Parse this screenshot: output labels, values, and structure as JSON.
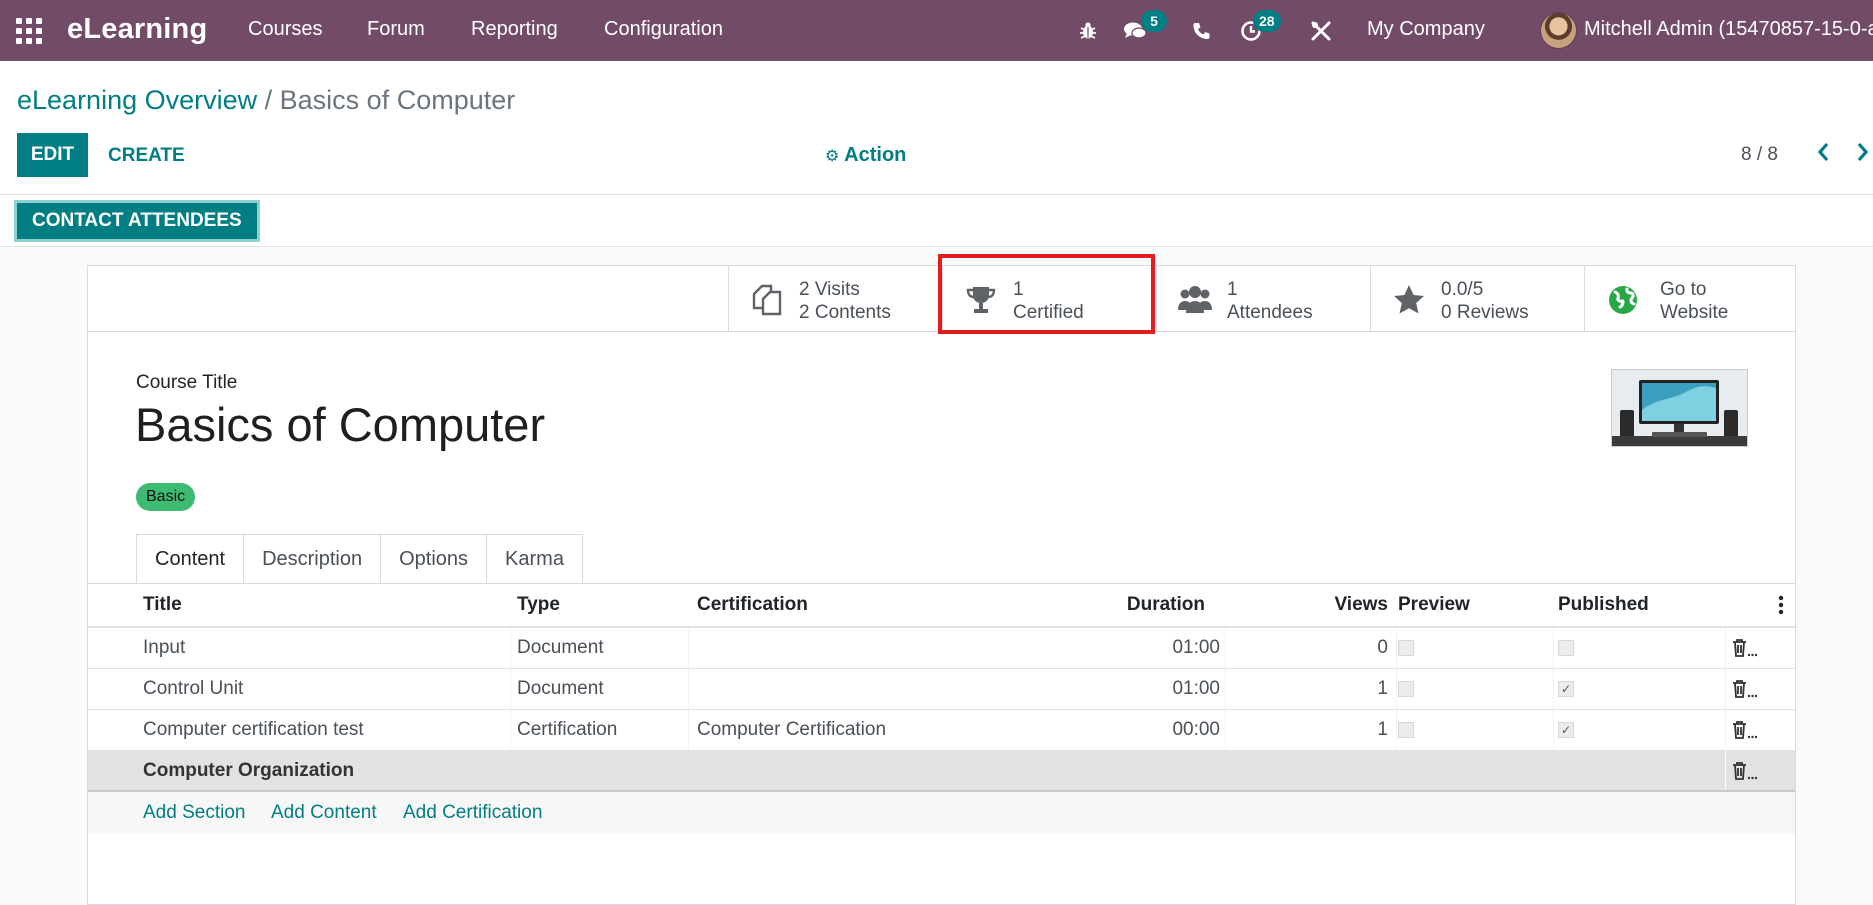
{
  "navbar": {
    "app_name": "eLearning",
    "menu": [
      "Courses",
      "Forum",
      "Reporting",
      "Configuration"
    ],
    "messages_badge": "5",
    "activities_badge": "28",
    "company": "My Company",
    "user": "Mitchell Admin (15470857-15-0-a",
    "icons": [
      "apps-icon",
      "bug-icon",
      "chat-icon",
      "phone-icon",
      "clock-icon",
      "tools-icon"
    ],
    "color": "#714b67"
  },
  "breadcrumb": {
    "parent": "eLearning Overview",
    "separator": " / ",
    "current": "Basics of Computer"
  },
  "toolbar": {
    "edit": "EDIT",
    "create": "CREATE",
    "action": "Action",
    "pager": "8 / 8"
  },
  "statusbar": {
    "contact": "CONTACT ATTENDEES"
  },
  "stats": [
    {
      "line1": "2 Visits",
      "line2": "2 Contents",
      "icon": "copy-icon"
    },
    {
      "line1": "1",
      "line2": "Certified",
      "icon": "trophy-icon"
    },
    {
      "line1": "1",
      "line2": "Attendees",
      "icon": "users-icon"
    },
    {
      "line1": "0.0/5",
      "line2": "0 Reviews",
      "icon": "star-icon"
    },
    {
      "line1": "Go to",
      "line2": "Website",
      "icon": "globe-icon"
    }
  ],
  "course": {
    "label": "Course Title",
    "title": "Basics of Computer",
    "tag": "Basic"
  },
  "tabs": [
    "Content",
    "Description",
    "Options",
    "Karma"
  ],
  "table": {
    "headers": {
      "title": "Title",
      "type": "Type",
      "certification": "Certification",
      "duration": "Duration",
      "views": "Views",
      "preview": "Preview",
      "published": "Published"
    },
    "rows": [
      {
        "title": "Input",
        "type": "Document",
        "certification": "",
        "duration": "01:00",
        "views": "0",
        "preview": false,
        "published": false
      },
      {
        "title": "Control Unit",
        "type": "Document",
        "certification": "",
        "duration": "01:00",
        "views": "1",
        "preview": false,
        "published": true
      },
      {
        "title": "Computer certification test",
        "type": "Certification",
        "certification": "Computer Certification",
        "duration": "00:00",
        "views": "1",
        "preview": false,
        "published": true
      }
    ],
    "section": "Computer Organization",
    "add_links": [
      "Add Section",
      "Add Content",
      "Add Certification"
    ]
  },
  "colors": {
    "accent": "#017e84",
    "highlight": "#e11d1d",
    "tag": "#3dbb73"
  }
}
